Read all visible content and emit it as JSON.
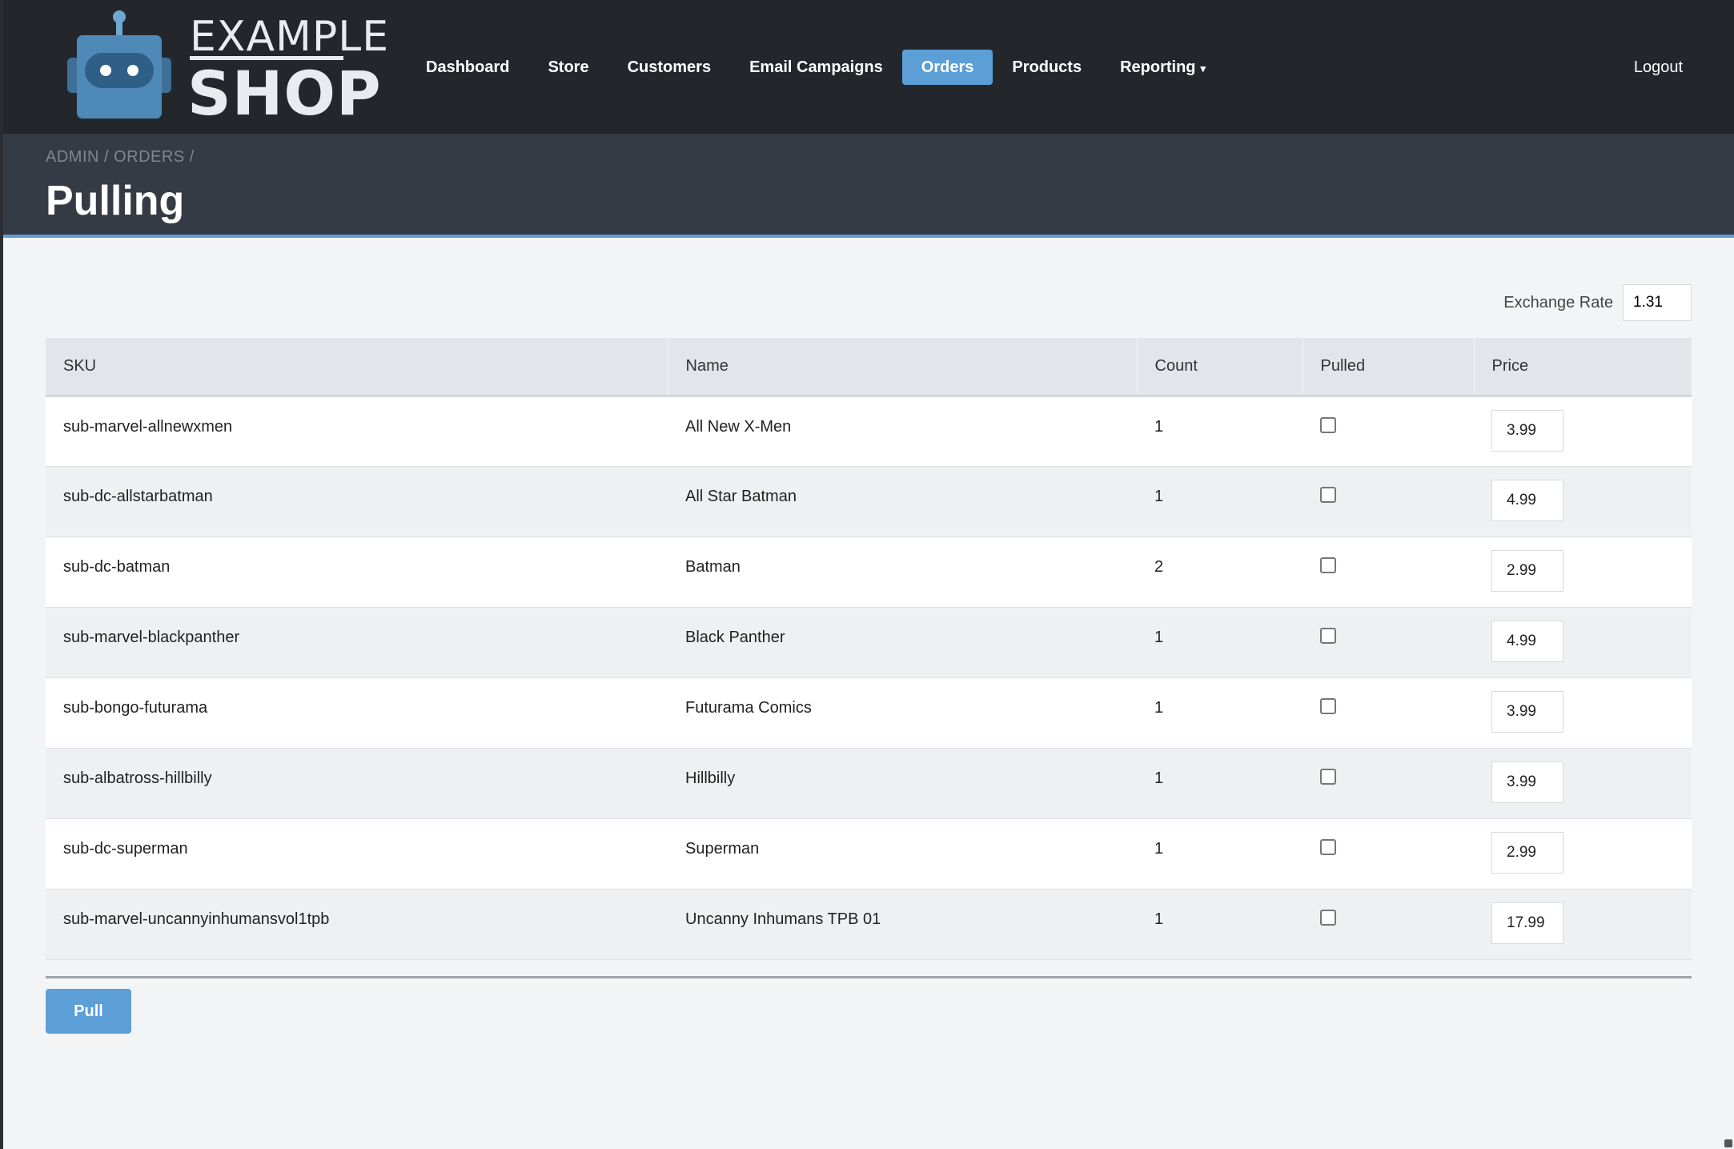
{
  "brand": {
    "line1": "EXAMPLE",
    "line2": "SHOP"
  },
  "nav": {
    "items": [
      {
        "label": "Dashboard",
        "active": false
      },
      {
        "label": "Store",
        "active": false
      },
      {
        "label": "Customers",
        "active": false
      },
      {
        "label": "Email Campaigns",
        "active": false
      },
      {
        "label": "Orders",
        "active": true
      },
      {
        "label": "Products",
        "active": false
      },
      {
        "label": "Reporting",
        "active": false,
        "dropdown": true
      }
    ],
    "logout": "Logout"
  },
  "header": {
    "breadcrumb": "ADMIN / ORDERS /",
    "title": "Pulling"
  },
  "exchange": {
    "label": "Exchange Rate",
    "value": "1.31"
  },
  "table": {
    "columns": [
      "SKU",
      "Name",
      "Count",
      "Pulled",
      "Price"
    ],
    "rows": [
      {
        "sku": "sub-marvel-allnewxmen",
        "name": "All New X-Men",
        "count": "1",
        "pulled": false,
        "price": "3.99"
      },
      {
        "sku": "sub-dc-allstarbatman",
        "name": "All Star Batman",
        "count": "1",
        "pulled": false,
        "price": "4.99"
      },
      {
        "sku": "sub-dc-batman",
        "name": "Batman",
        "count": "2",
        "pulled": false,
        "price": "2.99"
      },
      {
        "sku": "sub-marvel-blackpanther",
        "name": "Black Panther",
        "count": "1",
        "pulled": false,
        "price": "4.99"
      },
      {
        "sku": "sub-bongo-futurama",
        "name": "Futurama Comics",
        "count": "1",
        "pulled": false,
        "price": "3.99"
      },
      {
        "sku": "sub-albatross-hillbilly",
        "name": "Hillbilly",
        "count": "1",
        "pulled": false,
        "price": "3.99"
      },
      {
        "sku": "sub-dc-superman",
        "name": "Superman",
        "count": "1",
        "pulled": false,
        "price": "2.99"
      },
      {
        "sku": "sub-marvel-uncannyinhumansvol1tpb",
        "name": "Uncanny Inhumans TPB 01",
        "count": "1",
        "pulled": false,
        "price": "17.99"
      }
    ]
  },
  "actions": {
    "pull_label": "Pull"
  },
  "colors": {
    "accent": "#5b9fd6",
    "navbar": "#23272c",
    "header": "#353b44"
  }
}
